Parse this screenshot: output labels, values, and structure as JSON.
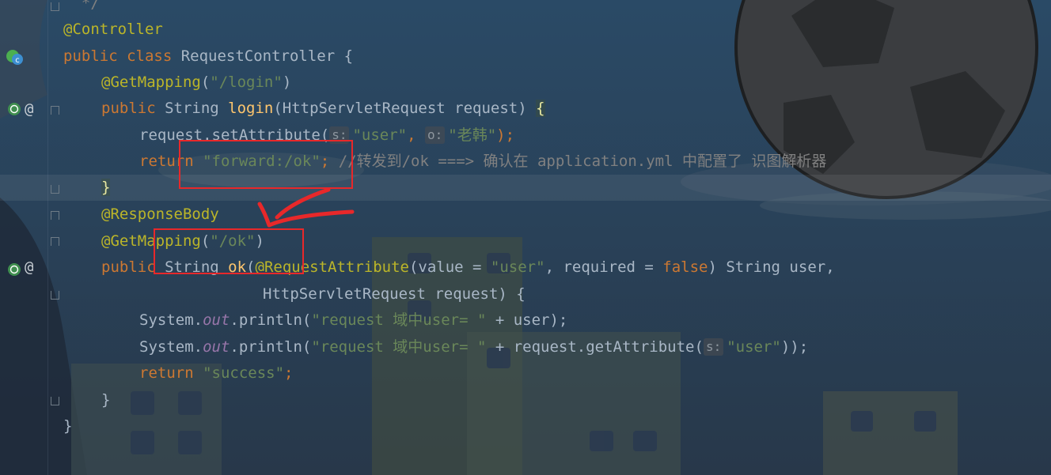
{
  "colors": {
    "background": "#2b3a4d",
    "keyword": "#cc7832",
    "annotation": "#bbb529",
    "string": "#6a8759",
    "method": "#ffc66d",
    "field": "#9876aa",
    "comment": "#808080",
    "plain": "#a9b7c6",
    "marker": "#e8282a"
  },
  "gutter_icons": [
    "spring-bean-class-icon",
    "request-mapping-icon",
    "at-icon",
    "fold-icon"
  ],
  "code": {
    "l0": "  */",
    "l1": "@Controller",
    "l2_kw": "public class ",
    "l2_name": "RequestController {",
    "l3_ann": "@GetMapping",
    "l3_p1": "(",
    "l3_str": "\"/login\"",
    "l3_p2": ")",
    "l4_kw": "public ",
    "l4_type": "String ",
    "l4_fn": "login",
    "l4_args": "(HttpServletRequest request) ",
    "l4_brace": "{",
    "l5_a": "request.setAttribute(",
    "l5_hint1": "s:",
    "l5_str1": "\"user\"",
    "l5_comma": ", ",
    "l5_hint2": "o:",
    "l5_str2": "\"老韩\"",
    "l5_end": ");",
    "l6_kw": "return ",
    "l6_str": "\"forward:/ok\"",
    "l6_semi": "; ",
    "l6_comment": "//转发到/ok ===> 确认在 application.yml 中配置了 识图解析器",
    "l7_brace": "}",
    "l8_ann": "@ResponseBody",
    "l9_ann": "@GetMapping",
    "l9_p1": "(",
    "l9_str": "\"/ok\"",
    "l9_p2": ")",
    "l10_kw": "public ",
    "l10_type": "String ",
    "l10_fn": "ok",
    "l10_p": "(",
    "l10_ann": "@RequestAttribute",
    "l10_a": "(value = ",
    "l10_str": "\"user\"",
    "l10_b": ", required = ",
    "l10_false": "false",
    "l10_c": ") String user,",
    "l11": "HttpServletRequest request) {",
    "l12_a": "System.",
    "l12_out": "out",
    "l12_b": ".println(",
    "l12_str": "\"request 域中user= \"",
    "l12_c": " + user);",
    "l13_a": "System.",
    "l13_out": "out",
    "l13_b": ".println(",
    "l13_str": "\"request 域中user= \"",
    "l13_c": " + request.getAttribute(",
    "l13_hint": "s:",
    "l13_str2": "\"user\"",
    "l13_d": "));",
    "l14_kw": "return ",
    "l14_str": "\"success\"",
    "l14_semi": ";",
    "l15": "}",
    "l16": "}"
  }
}
